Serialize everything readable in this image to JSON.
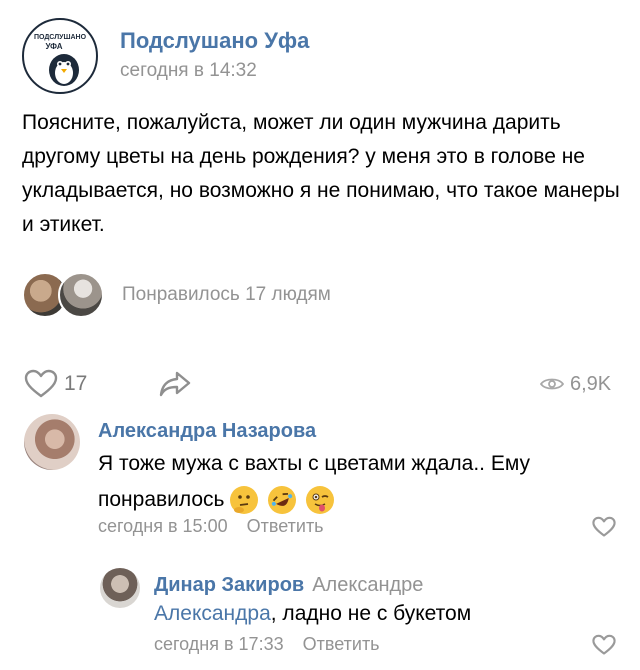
{
  "post": {
    "group_name": "Подслушано Уфа",
    "time": "сегодня в 14:32",
    "avatar_text_top": "ПОДСЛУШАНО",
    "avatar_text_bottom": "УФА",
    "text": "Поясните, пожалуйста, может ли один мужчина дарить другому цветы на день рождения? у меня это в голове не укладывается, но возможно я не понимаю, что такое манеры и этикет.",
    "liked_text": "Понравилось 17 людям",
    "likes_count": "17",
    "views_count": "6,9K"
  },
  "comments": [
    {
      "author": "Александра Назарова",
      "text": "Я тоже мужа с вахты с цветами ждала.. Ему понравилось",
      "emojis": [
        "thinking-face",
        "rolling-laughing-face",
        "winking-tongue-face"
      ],
      "time": "сегодня в 15:00",
      "reply_label": "Ответить"
    },
    {
      "author": "Динар Закиров",
      "reply_to": "Александре",
      "mention": "Александра",
      "text": ", ладно не с букетом",
      "time": "сегодня в 17:33",
      "reply_label": "Ответить"
    }
  ],
  "colors": {
    "link_blue": "#4a76a8",
    "meta_gray": "#939393",
    "icon_gray": "#9aa0a6"
  }
}
